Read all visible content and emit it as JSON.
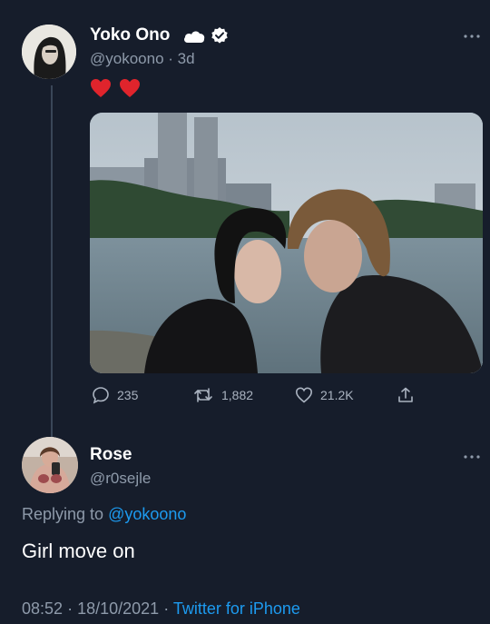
{
  "original_tweet": {
    "display_name": "Yoko Ono",
    "handle": "@yokoono",
    "separator": "·",
    "age": "3d",
    "name_icons": [
      "cloud-icon",
      "verified-badge-icon"
    ],
    "text_emoji": "❤️❤️",
    "more_icon": "more-options-icon",
    "photo": "photo-couple-kissing-by-lake",
    "actions": {
      "reply_count": "235",
      "retweet_count": "1,882",
      "like_count": "21.2K",
      "icons": [
        "reply-icon",
        "retweet-icon",
        "like-icon",
        "share-icon"
      ]
    }
  },
  "reply_tweet": {
    "display_name": "Rose",
    "handle": "@r0sejle",
    "replying_prefix": "Replying to",
    "replying_handle": "@yokoono",
    "text": "Girl move on",
    "time": "08:52",
    "date": "18/10/2021",
    "source": "Twitter for iPhone",
    "separator": "·",
    "more_icon": "more-options-icon"
  },
  "colors": {
    "background": "#161d2b",
    "accent": "#1d9bf0",
    "secondary_text": "#8e9aaa"
  }
}
